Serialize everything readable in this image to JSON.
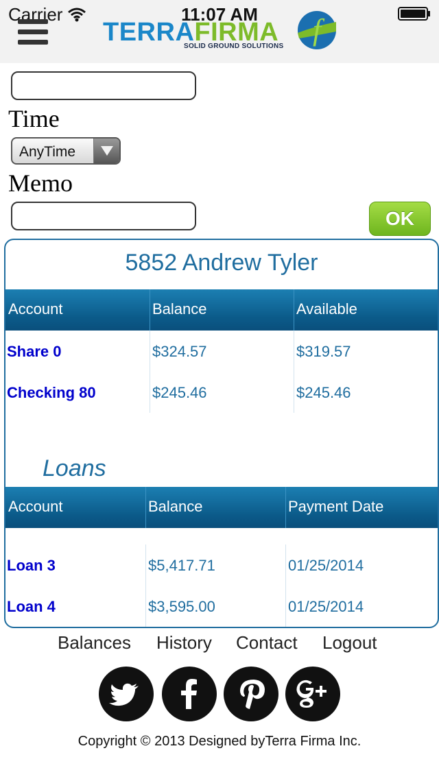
{
  "status_bar": {
    "carrier": "Carrier",
    "time": "11:07 AM"
  },
  "header": {
    "logo_terra": "TERRA",
    "logo_firma": "FIRMA",
    "logo_mark": "f",
    "logo_tagline": "SOLID GROUND SOLUTIONS"
  },
  "form": {
    "top_field_value": "",
    "time_label": "Time",
    "time_selected": "AnyTime",
    "memo_label": "Memo",
    "memo_value": "",
    "ok_label": "OK"
  },
  "accounts": {
    "member_title": "5852 Andrew Tyler",
    "headers": [
      "Account",
      "Balance",
      "Available"
    ],
    "rows": [
      {
        "account": "Share 0",
        "balance": "$324.57",
        "available": "$319.57"
      },
      {
        "account": "Checking 80",
        "balance": "$245.46",
        "available": "$245.46"
      }
    ]
  },
  "loans": {
    "title": "Loans",
    "headers": [
      "Account",
      "Balance",
      "Payment Date"
    ],
    "rows": [
      {
        "account": "Loan 3",
        "balance": "$5,417.71",
        "payment_date": "01/25/2014"
      },
      {
        "account": "Loan 4",
        "balance": "$3,595.00",
        "payment_date": "01/25/2014"
      }
    ]
  },
  "footer": {
    "nav": [
      "Balances",
      "History",
      "Contact",
      "Logout"
    ],
    "social_icons": [
      "twitter-icon",
      "facebook-icon",
      "pinterest-icon",
      "google-plus-icon"
    ],
    "copyright": "Copyright © 2013 Designed byTerra Firma Inc."
  },
  "colors": {
    "brand_blue": "#1f6d9f",
    "header_blue": "#0b5a89",
    "link_blue": "#0000cc",
    "ok_green": "#7dbb2a"
  }
}
